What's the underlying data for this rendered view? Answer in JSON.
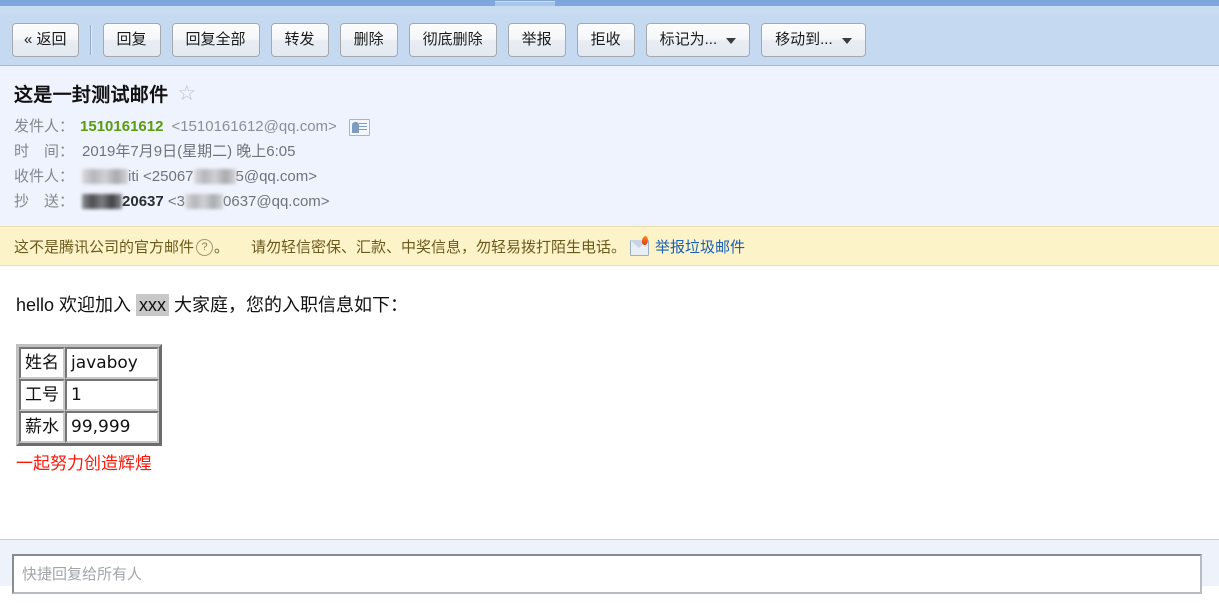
{
  "toolbar": {
    "buttons": [
      {
        "label": "« 返回",
        "name": "back-button",
        "caret": false
      },
      {
        "label": "回复",
        "name": "reply-button",
        "caret": false
      },
      {
        "label": "回复全部",
        "name": "reply-all-button",
        "caret": false
      },
      {
        "label": "转发",
        "name": "forward-button",
        "caret": false
      },
      {
        "label": "删除",
        "name": "delete-button",
        "caret": false
      },
      {
        "label": "彻底删除",
        "name": "delete-permanently-button",
        "caret": false
      },
      {
        "label": "举报",
        "name": "report-button",
        "caret": false
      },
      {
        "label": "拒收",
        "name": "reject-button",
        "caret": false
      },
      {
        "label": "标记为...",
        "name": "mark-as-dropdown",
        "caret": true
      },
      {
        "label": "移动到...",
        "name": "move-to-dropdown",
        "caret": true
      }
    ]
  },
  "mail": {
    "subject": "这是一封测试邮件",
    "star_glyph": "☆",
    "from_label": "发件人：",
    "from_name": "1510161612",
    "from_address": "<1510161612@qq.com>",
    "time_label": "时　间：",
    "time_value": "2019年7月9日(星期二) 晚上6:05",
    "to_label": "收件人：",
    "to_name_suffix": "iti",
    "to_address_prefix": "<25067",
    "to_address_suffix": "5@qq.com>",
    "cc_label": "抄　送：",
    "cc_name_suffix": "20637",
    "cc_address_prefix": "<3",
    "cc_address_suffix": "0637@qq.com>"
  },
  "warning": {
    "text_before_help": "这不是腾讯公司的官方邮件",
    "help_glyph": "?",
    "text_after_help": "。",
    "advice": "请勿轻信密保、汇款、中奖信息，勿轻易拨打陌生电话。",
    "spam_link": "举报垃圾邮件"
  },
  "body": {
    "greeting_before": "hello 欢迎加入 ",
    "greeting_highlight": "xxx",
    "greeting_after": " 大家庭，您的入职信息如下：",
    "table": {
      "rows": [
        {
          "key": "姓名",
          "value": "javaboy"
        },
        {
          "key": "工号",
          "value": "1"
        },
        {
          "key": "薪水",
          "value": "99,999"
        }
      ]
    },
    "closing": "一起努力创造辉煌"
  },
  "footer": {
    "quick_reply_placeholder": "快捷回复给所有人"
  },
  "colors": {
    "toolbar_bg": "#c5d9f1",
    "header_bg": "#eff3fd",
    "warning_bg": "#fcf3c8",
    "sender_green": "#5a9b10",
    "link_blue": "#1a5fb4",
    "closing_red": "#fc1708"
  }
}
